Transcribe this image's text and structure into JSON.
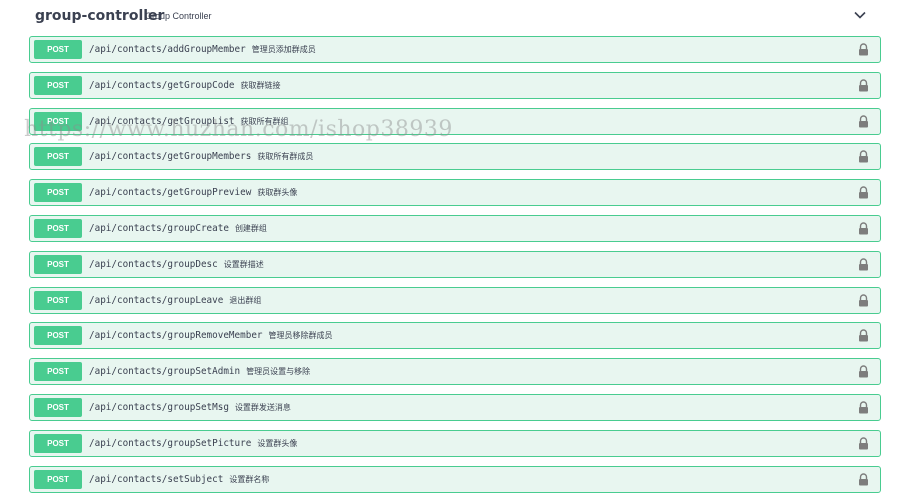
{
  "tag": {
    "name": "group-controller",
    "description": "Group Controller"
  },
  "icons": {
    "collapse": "chevron-down-icon",
    "auth": "lock-icon"
  },
  "colors": {
    "post_accent": "#49cc90",
    "post_background": "#e8f6f0",
    "text": "#3b4151"
  },
  "operations": [
    {
      "method": "POST",
      "path": "/api/contacts/addGroupMember",
      "summary": "管理员添加群成员"
    },
    {
      "method": "POST",
      "path": "/api/contacts/getGroupCode",
      "summary": "获取群链接"
    },
    {
      "method": "POST",
      "path": "/api/contacts/getGroupList",
      "summary": "获取所有群组"
    },
    {
      "method": "POST",
      "path": "/api/contacts/getGroupMembers",
      "summary": "获取所有群成员"
    },
    {
      "method": "POST",
      "path": "/api/contacts/getGroupPreview",
      "summary": "获取群头像"
    },
    {
      "method": "POST",
      "path": "/api/contacts/groupCreate",
      "summary": "创建群组"
    },
    {
      "method": "POST",
      "path": "/api/contacts/groupDesc",
      "summary": "设置群描述"
    },
    {
      "method": "POST",
      "path": "/api/contacts/groupLeave",
      "summary": "退出群组"
    },
    {
      "method": "POST",
      "path": "/api/contacts/groupRemoveMember",
      "summary": "管理员移除群成员"
    },
    {
      "method": "POST",
      "path": "/api/contacts/groupSetAdmin",
      "summary": "管理员设置与移除"
    },
    {
      "method": "POST",
      "path": "/api/contacts/groupSetMsg",
      "summary": "设置群发送消息"
    },
    {
      "method": "POST",
      "path": "/api/contacts/groupSetPicture",
      "summary": "设置群头像"
    },
    {
      "method": "POST",
      "path": "/api/contacts/setSubject",
      "summary": "设置群名称"
    }
  ],
  "watermark": "https://www.huzhan.com/ishop38939"
}
